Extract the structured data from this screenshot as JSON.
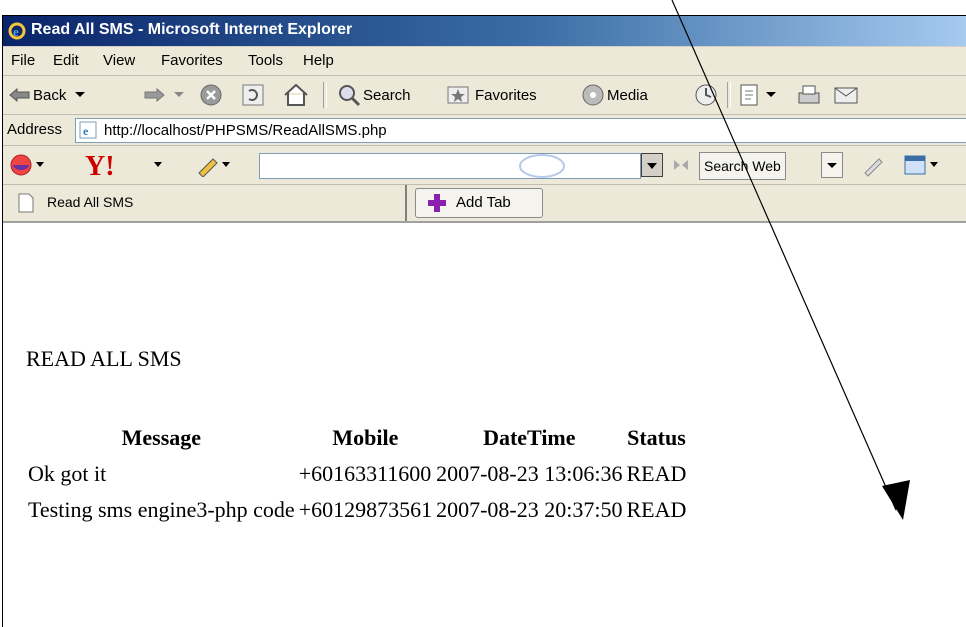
{
  "window": {
    "title": "Read All SMS - Microsoft Internet Explorer"
  },
  "menu": [
    "File",
    "Edit",
    "View",
    "Favorites",
    "Tools",
    "Help"
  ],
  "toolbar": {
    "back_label": "Back",
    "search_label": "Search",
    "favorites_label": "Favorites",
    "media_label": "Media"
  },
  "address": {
    "label": "Address",
    "url": "http://localhost/PHPSMS/ReadAllSMS.php"
  },
  "yahoo": {
    "search_web_label": "Search Web"
  },
  "tabs": {
    "current_tab": "Read All SMS",
    "add_tab_label": "Add Tab"
  },
  "page": {
    "title": "READ ALL SMS",
    "columns": [
      "Message",
      "Mobile",
      "DateTime",
      "Status"
    ],
    "rows": [
      [
        "Ok got it",
        "+60163311600",
        "2007-08-23 13:06:36",
        "READ"
      ],
      [
        "Testing sms engine3-php code",
        "+60129873561",
        "2007-08-23 20:37:50",
        "READ"
      ]
    ]
  },
  "colors": {
    "titlebar": "#0a246a",
    "chrome": "#ece9d8"
  }
}
